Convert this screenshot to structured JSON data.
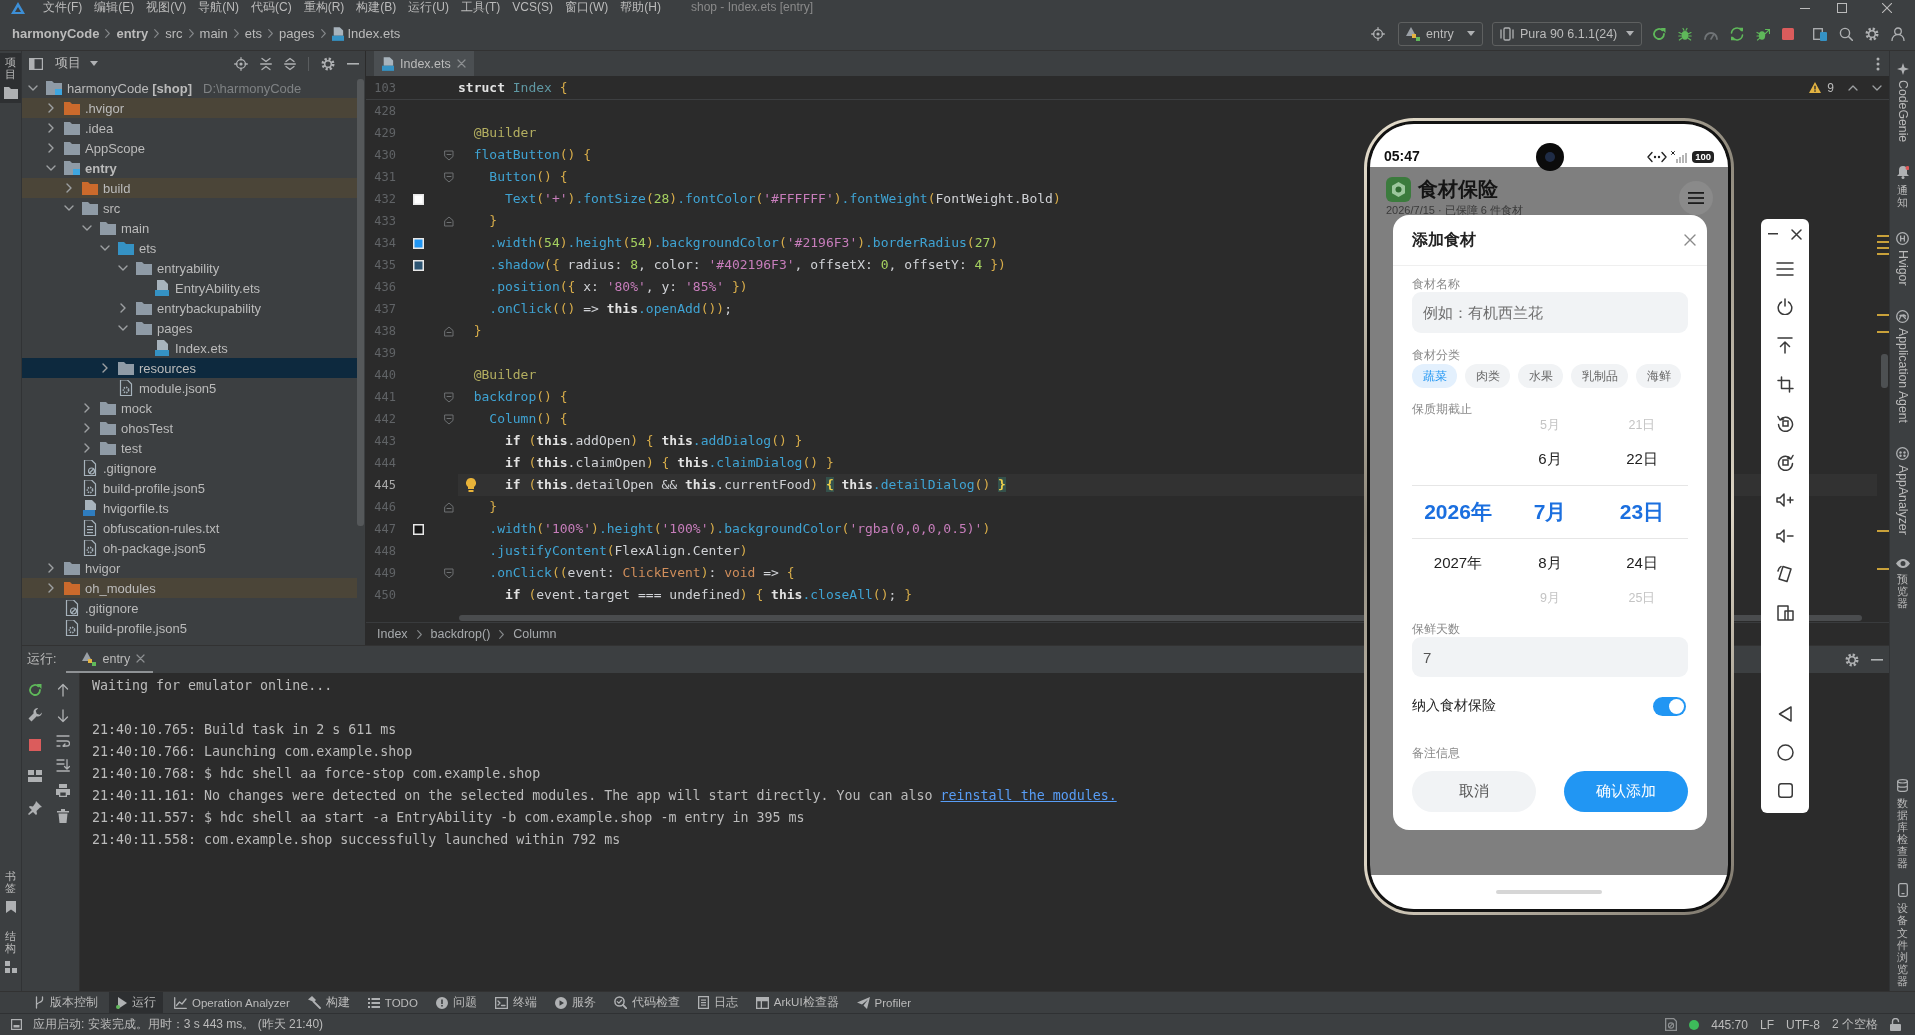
{
  "menu_bar": {
    "items": [
      "文件(F)",
      "编辑(E)",
      "视图(V)",
      "导航(N)",
      "代码(C)",
      "重构(R)",
      "构建(B)",
      "运行(U)",
      "工具(T)",
      "VCS(S)",
      "窗口(W)",
      "帮助(H)"
    ],
    "title": "shop - Index.ets [entry]"
  },
  "nav_bar": {
    "breadcrumb": [
      {
        "label": "harmonyCode",
        "kind": "project"
      },
      {
        "label": "entry",
        "kind": "module"
      },
      {
        "label": "src",
        "kind": "folder"
      },
      {
        "label": "main",
        "kind": "folder"
      },
      {
        "label": "ets",
        "kind": "folder"
      },
      {
        "label": "pages",
        "kind": "folder"
      },
      {
        "label": "Index.ets",
        "kind": "ets"
      }
    ],
    "run_config": "entry",
    "device": "Pura 90 6.1.1(24)"
  },
  "left_strip": {
    "top": [
      {
        "label": "项目",
        "selected": true
      }
    ],
    "bottom": [
      {
        "label": "书签",
        "selected": false
      },
      {
        "label": "结构",
        "selected": false
      }
    ]
  },
  "project_panel": {
    "title": "项目",
    "tree": [
      {
        "label": "harmonyCode **[shop]**",
        "path": "D:\\harmonyCode",
        "kind": "project",
        "expanded": true,
        "selected": false,
        "children": [
          {
            "label": ".hvigor",
            "kind": "excluded",
            "expanded": false,
            "selected": false
          },
          {
            "label": ".idea",
            "kind": "folder",
            "expanded": false,
            "selected": false
          },
          {
            "label": "AppScope",
            "kind": "folder",
            "expanded": false,
            "selected": false
          },
          {
            "label": "entry",
            "kind": "module",
            "expanded": true,
            "selected": false,
            "children": [
              {
                "label": "build",
                "kind": "excluded",
                "expanded": false,
                "selected": false
              },
              {
                "label": "src",
                "kind": "folder",
                "expanded": true,
                "selected": false,
                "children": [
                  {
                    "label": "main",
                    "kind": "folder",
                    "expanded": true,
                    "selected": false,
                    "children": [
                      {
                        "label": "ets",
                        "kind": "source",
                        "expanded": true,
                        "selected": false,
                        "children": [
                          {
                            "label": "entryability",
                            "kind": "folder",
                            "expanded": true,
                            "selected": false,
                            "children": [
                              {
                                "label": "EntryAbility.ets",
                                "kind": "ets",
                                "selected": false
                              }
                            ]
                          },
                          {
                            "label": "entrybackupability",
                            "kind": "folder",
                            "expanded": false,
                            "selected": false
                          },
                          {
                            "label": "pages",
                            "kind": "folder",
                            "expanded": true,
                            "selected": false,
                            "children": [
                              {
                                "label": "Index.ets",
                                "kind": "ets",
                                "selected": false
                              }
                            ]
                          }
                        ]
                      },
                      {
                        "label": "resources",
                        "kind": "folder",
                        "expanded": false,
                        "selected": true
                      },
                      {
                        "label": "module.json5",
                        "kind": "json",
                        "selected": false
                      }
                    ]
                  },
                  {
                    "label": "mock",
                    "kind": "folder",
                    "expanded": false,
                    "selected": false
                  },
                  {
                    "label": "ohosTest",
                    "kind": "folder",
                    "expanded": false,
                    "selected": false
                  },
                  {
                    "label": "test",
                    "kind": "folder",
                    "expanded": false,
                    "selected": false
                  }
                ]
              },
              {
                "label": ".gitignore",
                "kind": "ignore",
                "selected": false
              },
              {
                "label": "build-profile.json5",
                "kind": "json",
                "selected": false
              },
              {
                "label": "hvigorfile.ts",
                "kind": "ts",
                "selected": false
              },
              {
                "label": "obfuscation-rules.txt",
                "kind": "txt",
                "selected": false
              },
              {
                "label": "oh-package.json5",
                "kind": "json",
                "selected": false
              }
            ]
          },
          {
            "label": "hvigor",
            "kind": "folder",
            "expanded": false,
            "selected": false
          },
          {
            "label": "oh_modules",
            "kind": "excluded",
            "expanded": false,
            "selected": false
          },
          {
            "label": ".gitignore",
            "kind": "ignore",
            "selected": false
          },
          {
            "label": "build-profile.json5",
            "kind": "json",
            "selected": false
          }
        ]
      }
    ]
  },
  "editor": {
    "tabs": [
      {
        "label": "Index.ets",
        "selected": true
      }
    ],
    "warnings": "9",
    "sticky_line": {
      "number": "103",
      "tokens": [
        {
          "kind": "keyword",
          "text": "struct "
        },
        {
          "kind": "class",
          "text": "Index "
        },
        {
          "kind": "bracket",
          "text": "{"
        }
      ]
    },
    "lines": [
      {
        "number": "428",
        "current": false
      },
      {
        "number": "429",
        "current": false,
        "tokens": [
          {
            "kind": "annotation",
            "text": "  @Builder"
          }
        ]
      },
      {
        "number": "430",
        "current": false,
        "fold_start": true,
        "tokens": [
          {
            "kind": "func",
            "text": "  floatButton"
          },
          {
            "kind": "bracket",
            "text": "() {"
          }
        ]
      },
      {
        "number": "431",
        "current": false,
        "fold_start": true,
        "tokens": [
          {
            "kind": "func",
            "text": "    Button"
          },
          {
            "kind": "bracket",
            "text": "() {"
          }
        ]
      },
      {
        "number": "432",
        "current": false,
        "color": "#ffffff",
        "tokens": [
          {
            "kind": "func",
            "text": "      Text"
          },
          {
            "kind": "bracket",
            "text": "("
          },
          {
            "kind": "string",
            "text": "'+'"
          },
          {
            "kind": "bracket",
            "text": ")"
          },
          {
            "kind": "func",
            "text": ".fontSize"
          },
          {
            "kind": "bracket",
            "text": "("
          },
          {
            "kind": "number",
            "text": "28"
          },
          {
            "kind": "bracket",
            "text": ")"
          },
          {
            "kind": "func",
            "text": ".fontColor"
          },
          {
            "kind": "bracket",
            "text": "("
          },
          {
            "kind": "string",
            "text": "'#FFFFFF'"
          },
          {
            "kind": "bracket",
            "text": ")"
          },
          {
            "kind": "func",
            "text": ".fontWeight"
          },
          {
            "kind": "bracket",
            "text": "("
          },
          {
            "kind": "plain",
            "text": "FontWeight.Bold"
          },
          {
            "kind": "bracket",
            "text": ")"
          }
        ]
      },
      {
        "number": "433",
        "current": false,
        "fold_end": true,
        "tokens": [
          {
            "kind": "bracket",
            "text": "    }"
          }
        ]
      },
      {
        "number": "434",
        "current": false,
        "color": "#2196f3",
        "tokens": [
          {
            "kind": "func",
            "text": "    .width"
          },
          {
            "kind": "bracket",
            "text": "("
          },
          {
            "kind": "number",
            "text": "54"
          },
          {
            "kind": "bracket",
            "text": ")"
          },
          {
            "kind": "func",
            "text": ".height"
          },
          {
            "kind": "bracket",
            "text": "("
          },
          {
            "kind": "number",
            "text": "54"
          },
          {
            "kind": "bracket",
            "text": ")"
          },
          {
            "kind": "func",
            "text": ".backgroundColor"
          },
          {
            "kind": "bracket",
            "text": "("
          },
          {
            "kind": "string",
            "text": "'#2196F3'"
          },
          {
            "kind": "bracket",
            "text": ")"
          },
          {
            "kind": "func",
            "text": ".borderRadius"
          },
          {
            "kind": "bracket",
            "text": "("
          },
          {
            "kind": "number",
            "text": "27"
          },
          {
            "kind": "bracket",
            "text": ")"
          }
        ]
      },
      {
        "number": "435",
        "current": false,
        "color": "#2d5573",
        "tokens": [
          {
            "kind": "func",
            "text": "    .shadow"
          },
          {
            "kind": "bracket",
            "text": "({"
          },
          {
            "kind": "plain",
            "text": " radius: "
          },
          {
            "kind": "number",
            "text": "8"
          },
          {
            "kind": "plain",
            "text": ", color: "
          },
          {
            "kind": "string",
            "text": "'#402196F3'"
          },
          {
            "kind": "plain",
            "text": ", offsetX: "
          },
          {
            "kind": "number",
            "text": "0"
          },
          {
            "kind": "plain",
            "text": ", offsetY: "
          },
          {
            "kind": "number",
            "text": "4"
          },
          {
            "kind": "bracket",
            "text": " })"
          }
        ]
      },
      {
        "number": "436",
        "current": false,
        "tokens": [
          {
            "kind": "func",
            "text": "    .position"
          },
          {
            "kind": "bracket",
            "text": "({"
          },
          {
            "kind": "plain",
            "text": " x: "
          },
          {
            "kind": "string",
            "text": "'80%'"
          },
          {
            "kind": "plain",
            "text": ", y: "
          },
          {
            "kind": "string",
            "text": "'85%'"
          },
          {
            "kind": "bracket",
            "text": " })"
          }
        ]
      },
      {
        "number": "437",
        "current": false,
        "tokens": [
          {
            "kind": "func",
            "text": "    .onClick"
          },
          {
            "kind": "bracket",
            "text": "(() "
          },
          {
            "kind": "plain",
            "text": "=> "
          },
          {
            "kind": "keyword",
            "text": "this"
          },
          {
            "kind": "func",
            "text": ".openAdd"
          },
          {
            "kind": "bracket",
            "text": "())"
          },
          {
            "kind": "plain",
            "text": ";"
          }
        ]
      },
      {
        "number": "438",
        "current": false,
        "fold_end": true,
        "tokens": [
          {
            "kind": "bracket",
            "text": "  }"
          }
        ]
      },
      {
        "number": "439",
        "current": false
      },
      {
        "number": "440",
        "current": false,
        "tokens": [
          {
            "kind": "annotation",
            "text": "  @Builder"
          }
        ]
      },
      {
        "number": "441",
        "current": false,
        "fold_start": true,
        "tokens": [
          {
            "kind": "func",
            "text": "  backdrop"
          },
          {
            "kind": "bracket",
            "text": "() {"
          }
        ]
      },
      {
        "number": "442",
        "current": false,
        "fold_start": true,
        "tokens": [
          {
            "kind": "func",
            "text": "    Column"
          },
          {
            "kind": "bracket",
            "text": "() {"
          }
        ]
      },
      {
        "number": "443",
        "current": false,
        "tokens": [
          {
            "kind": "keyword",
            "text": "      if "
          },
          {
            "kind": "bracket",
            "text": "("
          },
          {
            "kind": "keyword",
            "text": "this"
          },
          {
            "kind": "plain",
            "text": ".addOpen"
          },
          {
            "kind": "bracket",
            "text": ") { "
          },
          {
            "kind": "keyword",
            "text": "this"
          },
          {
            "kind": "func",
            "text": ".addDialog"
          },
          {
            "kind": "bracket",
            "text": "() }"
          }
        ]
      },
      {
        "number": "444",
        "current": false,
        "tokens": [
          {
            "kind": "keyword",
            "text": "      if "
          },
          {
            "kind": "bracket",
            "text": "("
          },
          {
            "kind": "keyword",
            "text": "this"
          },
          {
            "kind": "plain",
            "text": ".claimOpen"
          },
          {
            "kind": "bracket",
            "text": ") { "
          },
          {
            "kind": "keyword",
            "text": "this"
          },
          {
            "kind": "func",
            "text": ".claimDialog"
          },
          {
            "kind": "bracket",
            "text": "() }"
          }
        ]
      },
      {
        "number": "445",
        "current": true,
        "quick_fix": true,
        "tokens": [
          {
            "kind": "keyword",
            "text": "      if "
          },
          {
            "kind": "bracket",
            "text": "("
          },
          {
            "kind": "keyword",
            "text": "this"
          },
          {
            "kind": "plain",
            "text": ".detailOpen && "
          },
          {
            "kind": "keyword",
            "text": "this"
          },
          {
            "kind": "plain",
            "text": ".currentFood"
          },
          {
            "kind": "bracket",
            "text": ") "
          },
          {
            "kind": "match",
            "text": "{"
          },
          {
            "kind": "keyword",
            "text": " this"
          },
          {
            "kind": "func",
            "text": ".detailDialog"
          },
          {
            "kind": "bracket",
            "text": "() "
          },
          {
            "kind": "match",
            "text": "}"
          }
        ]
      },
      {
        "number": "446",
        "current": false,
        "fold_end": true,
        "tokens": [
          {
            "kind": "bracket",
            "text": "    }"
          }
        ]
      },
      {
        "number": "447",
        "current": false,
        "color": "#161616",
        "tokens": [
          {
            "kind": "func",
            "text": "    .width"
          },
          {
            "kind": "bracket",
            "text": "("
          },
          {
            "kind": "string",
            "text": "'100%'"
          },
          {
            "kind": "bracket",
            "text": ")"
          },
          {
            "kind": "func",
            "text": ".height"
          },
          {
            "kind": "bracket",
            "text": "("
          },
          {
            "kind": "string",
            "text": "'100%'"
          },
          {
            "kind": "bracket",
            "text": ")"
          },
          {
            "kind": "func",
            "text": ".backgroundColor"
          },
          {
            "kind": "bracket",
            "text": "("
          },
          {
            "kind": "string",
            "text": "'rgba(0,0,0,0.5)'"
          },
          {
            "kind": "bracket",
            "text": ")"
          }
        ]
      },
      {
        "number": "448",
        "current": false,
        "tokens": [
          {
            "kind": "func",
            "text": "    .justifyContent"
          },
          {
            "kind": "bracket",
            "text": "("
          },
          {
            "kind": "plain",
            "text": "FlexAlign.Center"
          },
          {
            "kind": "bracket",
            "text": ")"
          }
        ]
      },
      {
        "number": "449",
        "current": false,
        "fold_start": true,
        "tokens": [
          {
            "kind": "func",
            "text": "    .onClick"
          },
          {
            "kind": "bracket",
            "text": "(("
          },
          {
            "kind": "plain",
            "text": "event: "
          },
          {
            "kind": "type",
            "text": "ClickEvent"
          },
          {
            "kind": "bracket",
            "text": ")"
          },
          {
            "kind": "plain",
            "text": ": "
          },
          {
            "kind": "type",
            "text": "void"
          },
          {
            "kind": "plain",
            "text": " => "
          },
          {
            "kind": "bracket",
            "text": "{"
          }
        ]
      },
      {
        "number": "450",
        "current": false,
        "tokens": [
          {
            "kind": "keyword",
            "text": "      if "
          },
          {
            "kind": "bracket",
            "text": "("
          },
          {
            "kind": "plain",
            "text": "event.target === undefined"
          },
          {
            "kind": "bracket",
            "text": ") { "
          },
          {
            "kind": "keyword",
            "text": "this"
          },
          {
            "kind": "func",
            "text": ".closeAll"
          },
          {
            "kind": "bracket",
            "text": "()"
          },
          {
            "kind": "plain",
            "text": "; "
          },
          {
            "kind": "bracket",
            "text": "}"
          }
        ]
      }
    ],
    "breadcrumb": [
      "Index",
      "backdrop()",
      "Column"
    ]
  },
  "run_panel": {
    "title": "运行:",
    "tabs": [
      {
        "label": "entry",
        "selected": true
      }
    ],
    "console": [
      {
        "kind": "plain",
        "text": "Waiting for emulator online..."
      },
      {
        "kind": "blank"
      },
      {
        "kind": "plain",
        "text": "21:40:10.765: Build task in 2 s 611 ms"
      },
      {
        "kind": "plain",
        "text": "21:40:10.766: Launching com.example.shop"
      },
      {
        "kind": "plain",
        "text": "21:40:10.768: $ hdc shell aa force-stop com.example.shop"
      },
      {
        "kind": "link",
        "text": "21:40:11.161: No changes were detected on the selected modules. The app will start directly. You can also ",
        "link": "reinstall the modules."
      },
      {
        "kind": "plain",
        "text": "21:40:11.557: $ hdc shell aa start -a EntryAbility -b com.example.shop -m entry in 395 ms"
      },
      {
        "kind": "plain",
        "text": "21:40:11.558: com.example.shop successfully launched within 792 ms"
      }
    ]
  },
  "right_strip": {
    "top": [
      {
        "label": "CodeGenie",
        "kind": "latin"
      },
      {
        "label": "通知",
        "kind": "cjk"
      },
      {
        "label": "Hvigor",
        "kind": "latin"
      },
      {
        "label": "Application Agent",
        "kind": "latin"
      },
      {
        "label": "AppAnalyzer",
        "kind": "latin"
      },
      {
        "label": "预览器",
        "kind": "cjk"
      }
    ],
    "bottom": [
      {
        "label": "数据库检查器",
        "kind": "cjk"
      },
      {
        "label": "设备文件浏览器",
        "kind": "cjk"
      }
    ]
  },
  "emulator": {
    "status_bar": {
      "time": "05:47",
      "battery": "100"
    },
    "app": {
      "title": "食材保险",
      "subtitle": "2026/7/15 · 已保障 6 件食材"
    },
    "dialog": {
      "title": "添加食材",
      "name_field": {
        "label": "食材名称",
        "placeholder": "例如：有机西兰花"
      },
      "category": {
        "label": "食材分类",
        "options": [
          {
            "label": "蔬菜",
            "selected": true
          },
          {
            "label": "肉类",
            "selected": false
          },
          {
            "label": "水果",
            "selected": false
          },
          {
            "label": "乳制品",
            "selected": false
          },
          {
            "label": "海鲜",
            "selected": false
          }
        ]
      },
      "expiry": {
        "label": "保质期截止",
        "columns": [
          {
            "items": [
              {
                "text": "2026年",
                "selected": true
              },
              {
                "text": "2027年",
                "selected": false
              }
            ]
          },
          {
            "items": [
              {
                "text": "5月",
                "selected": false
              },
              {
                "text": "6月",
                "selected": false
              },
              {
                "text": "7月",
                "selected": true
              },
              {
                "text": "8月",
                "selected": false
              },
              {
                "text": "9月",
                "selected": false
              }
            ]
          },
          {
            "items": [
              {
                "text": "21日",
                "selected": false
              },
              {
                "text": "22日",
                "selected": false
              },
              {
                "text": "23日",
                "selected": true
              },
              {
                "text": "24日",
                "selected": false
              },
              {
                "text": "25日",
                "selected": false
              }
            ]
          }
        ]
      },
      "days_field": {
        "label": "保鲜天数",
        "value": "7"
      },
      "insured": {
        "label": "纳入食材保险",
        "on": true
      },
      "notes": {
        "label": "备注信息"
      },
      "buttons": [
        {
          "label": "取消",
          "kind": "secondary"
        },
        {
          "label": "确认添加",
          "kind": "primary"
        }
      ]
    }
  },
  "tool_bar": {
    "items": [
      {
        "label": "版本控制",
        "selected": false
      },
      {
        "label": "运行",
        "selected": true
      },
      {
        "label": "Operation Analyzer",
        "selected": false
      },
      {
        "label": "构建",
        "selected": false
      },
      {
        "label": "TODO",
        "selected": false
      },
      {
        "label": "问题",
        "selected": false
      },
      {
        "label": "终端",
        "selected": false
      },
      {
        "label": "服务",
        "selected": false
      },
      {
        "label": "代码检查",
        "selected": false
      },
      {
        "label": "日志",
        "selected": false
      },
      {
        "label": "ArkUI检查器",
        "selected": false
      },
      {
        "label": "Profiler",
        "selected": false
      }
    ]
  },
  "status_bar": {
    "message": "应用启动: 安装完成。用时：3 s 443 ms。 (昨天 21:40)",
    "position": "445:70",
    "line_ending": "LF",
    "encoding": "UTF-8",
    "indent": "2 个空格"
  }
}
